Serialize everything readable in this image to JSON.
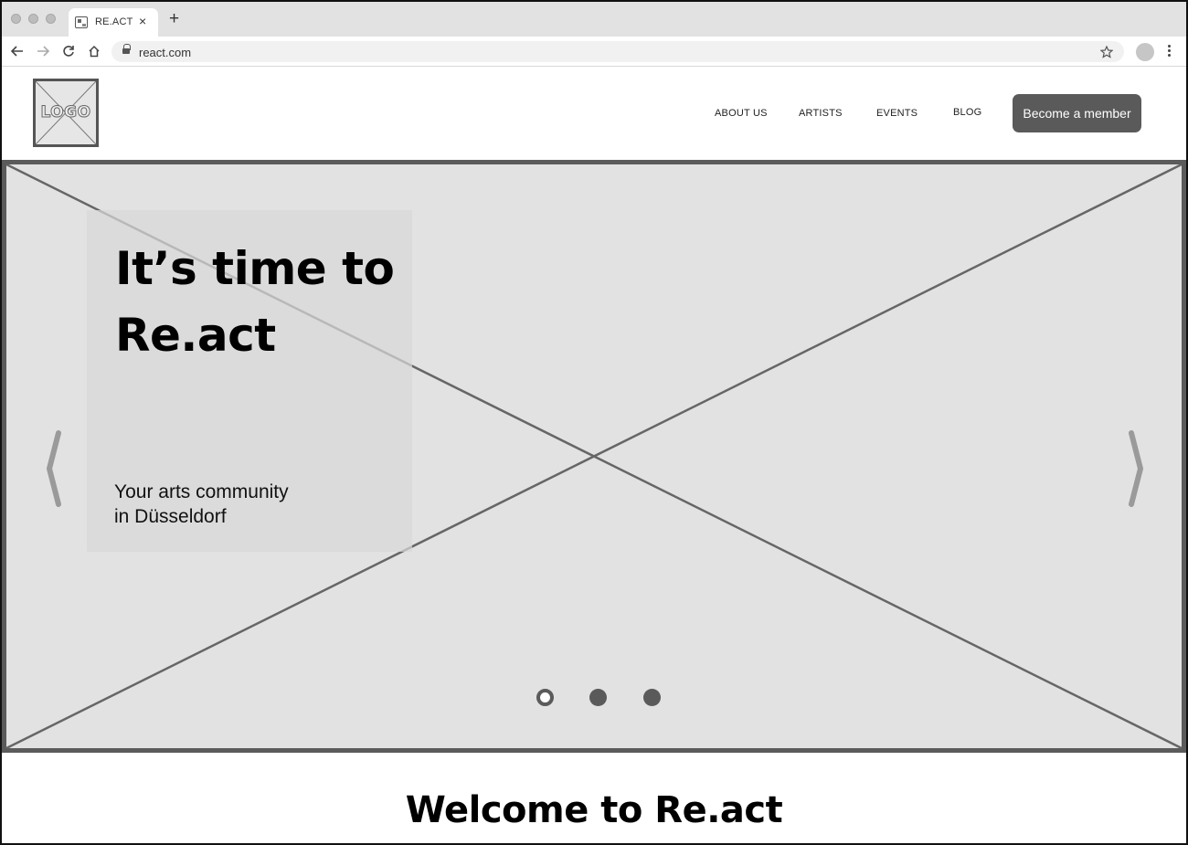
{
  "browser": {
    "tab_title": "RE.ACT",
    "tab_close": "×",
    "new_tab": "+",
    "url": "react.com",
    "icons": [
      "back-icon",
      "forward-icon",
      "reload-icon",
      "home-icon",
      "lock-icon",
      "star-icon",
      "profile-icon",
      "menu-icon"
    ]
  },
  "header": {
    "logo_text": "LOGO",
    "nav": [
      "ABOUT US",
      "ARTISTS",
      "EVENTS",
      "BLOG"
    ],
    "cta": "Become a member"
  },
  "hero": {
    "headline_line1": "It’s time to",
    "headline_line2": "Re.act",
    "tagline_line1": "Your arts community",
    "tagline_line2": "in Düsseldorf",
    "slides": 3,
    "active_slide": 1
  },
  "welcome": {
    "title": "Welcome to Re.act"
  }
}
